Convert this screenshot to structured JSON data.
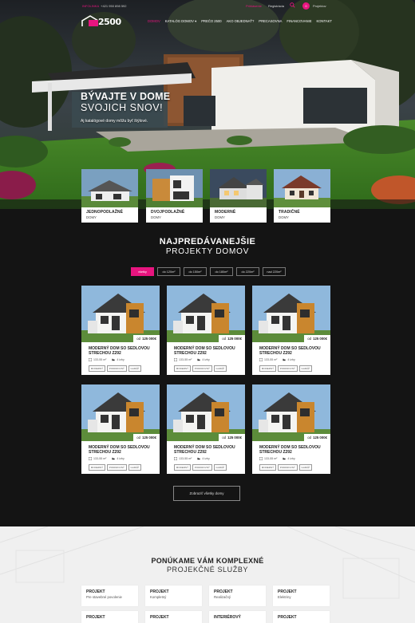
{
  "topbar": {
    "phone_label": "INFOLINKA",
    "phone": "+421 950 898 592",
    "login": "Prihlásenie",
    "register": "Registrácia",
    "favorites_count": "0",
    "projects_label": "Projektov"
  },
  "brand": {
    "name": "2500"
  },
  "nav": {
    "items": [
      "Domov",
      "Katalóg domov ▾",
      "Prečo 2500",
      "Ako objednať?",
      "Precasovna",
      "Financovanie",
      "Kontakt"
    ]
  },
  "hero": {
    "title": "BÝVAJTE V DOME",
    "subtitle": "SVOJICH SNOV!",
    "description": "Aj katalógové domy môžu byť štýlové."
  },
  "categories": [
    {
      "line1": "Jednopodlažné",
      "line2": "domy"
    },
    {
      "line1": "Dvojpodlažné",
      "line2": "domy"
    },
    {
      "line1": "Moderné",
      "line2": "domy"
    },
    {
      "line1": "Tradičné",
      "line2": "domy"
    }
  ],
  "bestsellers": {
    "title": "NAJPREDÁVANEJŠIE",
    "subtitle": "PROJEKTY DOMOV",
    "filters": [
      "všetky",
      "do 120m²",
      "do 150m²",
      "do 180m²",
      "do 220m²",
      "nad 220m²"
    ],
    "active_filter": 0,
    "products": [
      {
        "price_prefix": "od",
        "price": "125 000€",
        "name": "Moderný dom so sedlovou strechou Z292",
        "area": "133-55 m²",
        "rooms": "4 izby",
        "tags": [
          "Moderný",
          "Podkrovný",
          "Garáž"
        ]
      },
      {
        "price_prefix": "od",
        "price": "125 000€",
        "name": "Moderný dom so sedlovou strechou Z292",
        "area": "133-55 m²",
        "rooms": "4 izby",
        "tags": [
          "Moderný",
          "Podkrovný",
          "Garáž"
        ]
      },
      {
        "price_prefix": "od",
        "price": "125 000€",
        "name": "Moderný dom so sedlovou strechou Z292",
        "area": "133-55 m²",
        "rooms": "4 izby",
        "tags": [
          "Moderný",
          "Podkrovný",
          "Garáž"
        ]
      },
      {
        "price_prefix": "od",
        "price": "125 000€",
        "name": "Moderný dom so sedlovou strechou Z292",
        "area": "133-55 m²",
        "rooms": "4 izby",
        "tags": [
          "Moderný",
          "Podkrovný",
          "Garáž"
        ]
      },
      {
        "price_prefix": "od",
        "price": "125 000€",
        "name": "Moderný dom so sedlovou strechou Z292",
        "area": "133-55 m²",
        "rooms": "4 izby",
        "tags": [
          "Moderný",
          "Podkrovný",
          "Garáž"
        ]
      },
      {
        "price_prefix": "od",
        "price": "125 000€",
        "name": "Moderný dom so sedlovou strechou Z292",
        "area": "133-55 m²",
        "rooms": "4 izby",
        "tags": [
          "Moderný",
          "Podkrovný",
          "Garáž"
        ]
      }
    ],
    "show_all": "Zobraziť všetky domy"
  },
  "services": {
    "title": "PONÚKAME VÁM KOMPLEXNÉ",
    "subtitle": "PROJEKČNÉ SLUŽBY",
    "items": [
      {
        "line1": "Projekt",
        "line2": "Pre stavebné povolenie"
      },
      {
        "line1": "Projekt",
        "line2": "Kompletný"
      },
      {
        "line1": "Projekt",
        "line2": "Realizačný"
      },
      {
        "line1": "Projekt",
        "line2": "Elektriny"
      },
      {
        "line1": "Projekt",
        "line2": ""
      },
      {
        "line1": "Projekt",
        "line2": ""
      },
      {
        "line1": "Interiérový",
        "line2": ""
      },
      {
        "line1": "Projekt",
        "line2": ""
      }
    ]
  },
  "colors": {
    "accent": "#e8157f",
    "dark_bg": "#141414",
    "light_bg": "#f0f0f0"
  }
}
